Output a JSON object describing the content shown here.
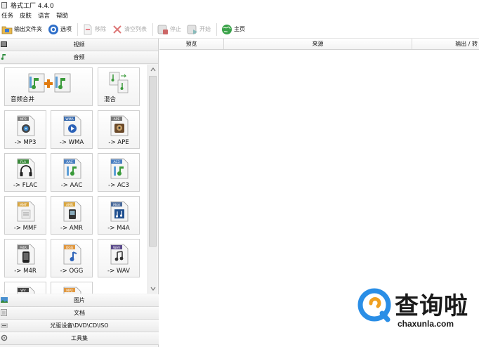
{
  "window": {
    "title": "格式工厂 4.4.0"
  },
  "menu": [
    "任务",
    "皮肤",
    "语言",
    "帮助"
  ],
  "toolbar": {
    "output_folder": "输出文件夹",
    "options": "选项",
    "remove": "移除",
    "clear_list": "清空列表",
    "stop": "停止",
    "start": "开始",
    "home": "主页"
  },
  "categories": {
    "video": "视频",
    "audio": "音频",
    "picture": "图片",
    "document": "文档",
    "rom": "光驱设备\\DVD\\CD\\ISO",
    "tools": "工具集"
  },
  "audio_tiles": {
    "merge": "音频合并",
    "mix": "混合",
    "mp3": "-> MP3",
    "wma": "-> WMA",
    "ape": "-> APE",
    "flac": "-> FLAC",
    "aac": "-> AAC",
    "ac3": "-> AC3",
    "mmf": "-> MMF",
    "amr": "-> AMR",
    "m4a": "-> M4A",
    "m4r": "-> M4R",
    "ogg": "-> OGG",
    "wav": "-> WAV"
  },
  "file_badges": {
    "mp3": "MP3",
    "wma": "WMA",
    "ape": "APE",
    "flac": "FLA",
    "aac": "AAC",
    "ac3": "AC3",
    "mmf": "MMF",
    "amr": "AMR",
    "m4a": "M4A",
    "m4r": "M4R",
    "ogg": "OGG",
    "wav": "WAV",
    "wv": "WV",
    "mp2": "MP2"
  },
  "table": {
    "columns": [
      "预览",
      "来源",
      "输出 / 转"
    ]
  },
  "watermark": {
    "text": "查询啦",
    "url": "chaxunla.com"
  },
  "colors": {
    "accent_blue": "#3b7fd4",
    "watermark_blue": "#2a8ee6",
    "badge_gray": "#6d6d6d"
  }
}
